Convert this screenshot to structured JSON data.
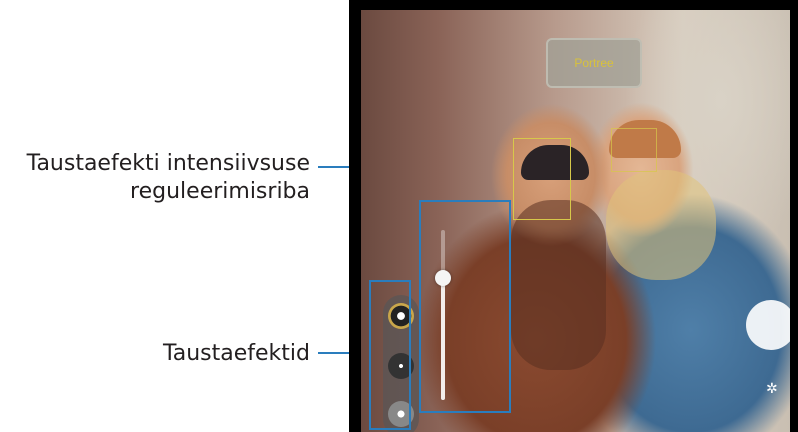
{
  "callouts": {
    "intensity_bar_line1": "Taustaefekti intensiivsuse",
    "intensity_bar_line2": "reguleerimisriba",
    "effects": "Taustaefektid"
  },
  "camera": {
    "mode_label": "Portree",
    "effect_level": 0.72
  },
  "colors": {
    "accent": "#2a7dbd",
    "face_box": "#d7c84a"
  }
}
